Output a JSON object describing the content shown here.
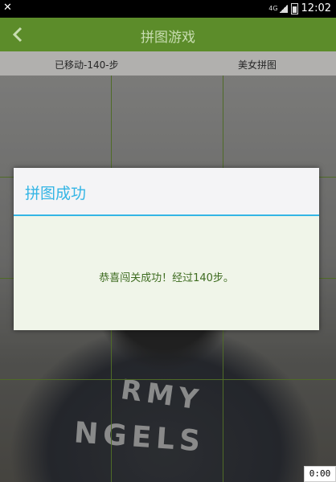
{
  "status_bar": {
    "network_type": "4G",
    "time": "12:02"
  },
  "action_bar": {
    "title": "拼图游戏"
  },
  "info_row": {
    "moves_text": "已移动-140-步",
    "puzzle_name": "美女拼图"
  },
  "board": {
    "grid": [
      3,
      4
    ],
    "shirt_text_line1": "RMY",
    "shirt_text_line2": "NGELS"
  },
  "dialog": {
    "title": "拼图成功",
    "message": "恭喜闯关成功！经过140步。"
  },
  "colors": {
    "action_bar": "#5c8c2a",
    "dialog_accent": "#33b5e5",
    "message_text": "#3d6b1f"
  },
  "overlay_badge": "0:00"
}
